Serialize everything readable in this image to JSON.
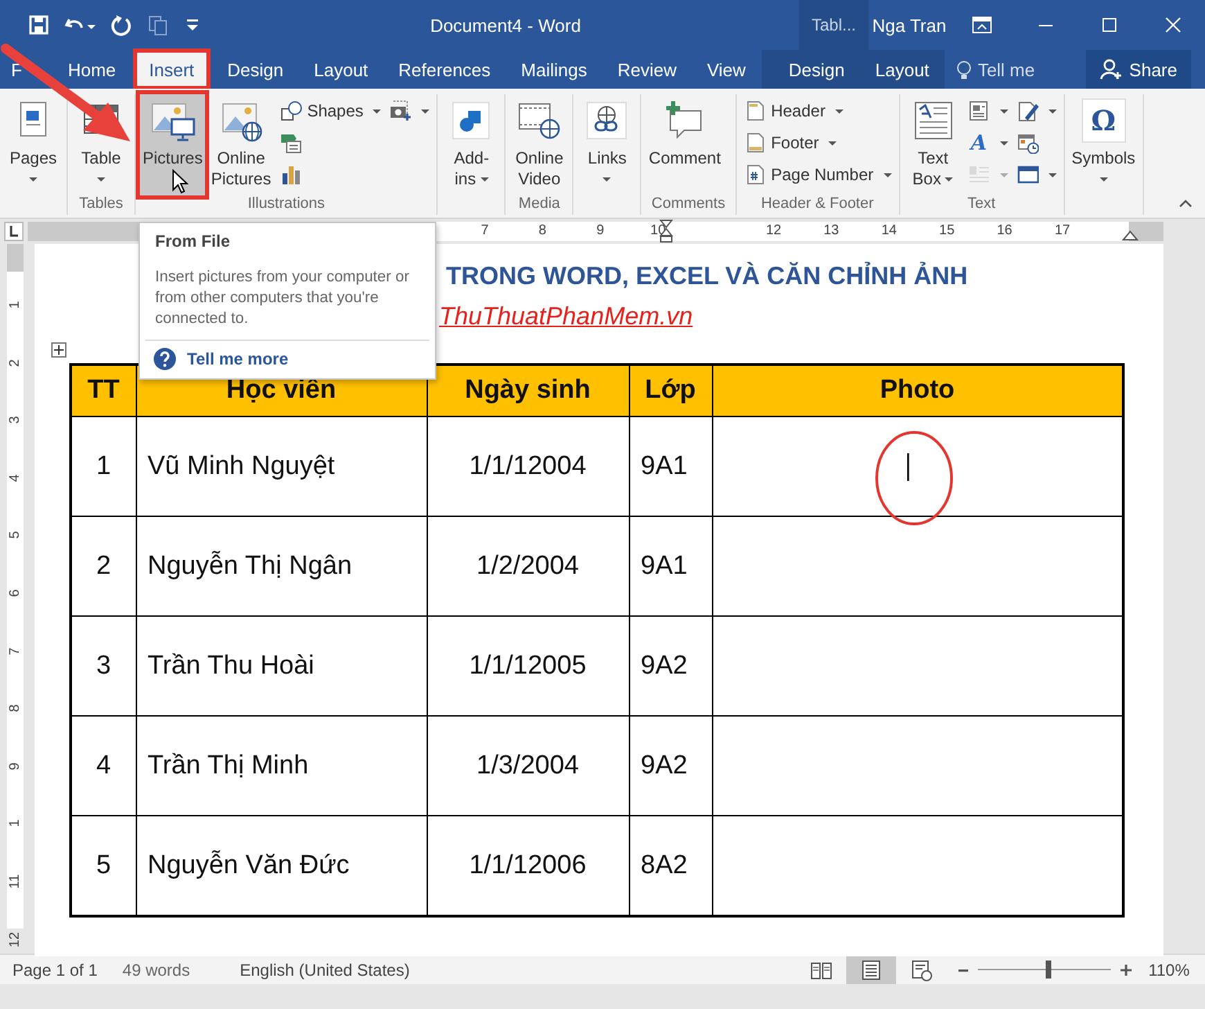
{
  "title_bar": {
    "title": "Document4  -  Word",
    "context_label": "Tabl...",
    "user": "Nga Tran"
  },
  "tabs": [
    {
      "label": "F",
      "selected": false,
      "contextual": false,
      "annotated": false
    },
    {
      "label": "Home",
      "selected": false,
      "contextual": false,
      "annotated": false
    },
    {
      "label": "Insert",
      "selected": true,
      "contextual": false,
      "annotated": true
    },
    {
      "label": "Design",
      "selected": false,
      "contextual": false,
      "annotated": false
    },
    {
      "label": "Layout",
      "selected": false,
      "contextual": false,
      "annotated": false
    },
    {
      "label": "References",
      "selected": false,
      "contextual": false,
      "annotated": false
    },
    {
      "label": "Mailings",
      "selected": false,
      "contextual": false,
      "annotated": false
    },
    {
      "label": "Review",
      "selected": false,
      "contextual": false,
      "annotated": false
    },
    {
      "label": "View",
      "selected": false,
      "contextual": false,
      "annotated": false
    },
    {
      "label": "Design",
      "selected": false,
      "contextual": true,
      "annotated": false
    },
    {
      "label": "Layout",
      "selected": false,
      "contextual": true,
      "annotated": false
    }
  ],
  "tell_me": "Tell me",
  "share": "Share",
  "callout_arrow": true,
  "ribbon": [
    {
      "columns": [
        {
          "kind": "large",
          "label": "Pages",
          "dropdown": true,
          "hovered": false,
          "annotated": false
        }
      ]
    },
    {
      "label": "Tables",
      "columns": [
        {
          "kind": "large",
          "label": "Table",
          "dropdown": true,
          "hovered": false,
          "annotated": false
        }
      ]
    },
    {
      "label": "Illustrations",
      "columns": [
        {
          "kind": "large",
          "label": "Pictures",
          "dropdown": false,
          "hovered": true,
          "annotated": true
        },
        {
          "kind": "large",
          "label": "Online Pictures",
          "dropdown": false,
          "hovered": false,
          "annotated": false
        },
        {
          "kind": "stack",
          "items": [
            {
              "label": "Shapes",
              "dropdown": true
            },
            {
              "dropdown": false
            },
            {
              "dropdown": false
            }
          ]
        },
        {
          "kind": "stack",
          "items": [
            {
              "dropdown": true
            }
          ]
        }
      ]
    },
    {
      "columns": [
        {
          "kind": "large",
          "label": "Add-ins",
          "dropdown": true,
          "hovered": false,
          "annotated": false
        }
      ]
    },
    {
      "label": "Media",
      "columns": [
        {
          "kind": "large",
          "label": "Online Video",
          "dropdown": false,
          "hovered": false,
          "annotated": false
        }
      ]
    },
    {
      "columns": [
        {
          "kind": "large",
          "label": "Links",
          "dropdown": true,
          "hovered": false,
          "annotated": false
        }
      ]
    },
    {
      "label": "Comments",
      "columns": [
        {
          "kind": "large",
          "label": "Comment",
          "dropdown": false,
          "hovered": false,
          "annotated": false
        }
      ]
    },
    {
      "label": "Header & Footer",
      "columns": [
        {
          "kind": "stack",
          "items": [
            {
              "label": "Header",
              "dropdown": true
            },
            {
              "label": "Footer",
              "dropdown": true
            },
            {
              "label": "Page Number",
              "dropdown": true
            }
          ]
        }
      ]
    },
    {
      "label": "Text",
      "columns": [
        {
          "kind": "large",
          "label": "Text Box",
          "dropdown": true,
          "hovered": false,
          "annotated": false
        },
        {
          "kind": "stack",
          "items": [
            {
              "dropdown": true,
              "disabled": false
            },
            {
              "glyph": "A",
              "dropdown": true,
              "disabled": false
            },
            {
              "dropdown": true,
              "disabled": true
            }
          ]
        },
        {
          "kind": "stack",
          "items": [
            {
              "dropdown": true,
              "disabled": false
            },
            {
              "dropdown": false,
              "disabled": false
            },
            {
              "dropdown": true,
              "disabled": false
            }
          ]
        }
      ]
    },
    {
      "columns": [
        {
          "kind": "large",
          "label": "Symbols",
          "glyph": "Ω",
          "dropdown": true,
          "hovered": false,
          "annotated": false
        }
      ]
    }
  ],
  "ruler": {
    "numbers": [
      "7",
      "8",
      "9",
      "10",
      "12",
      "13",
      "14",
      "15",
      "16",
      "17"
    ]
  },
  "vertical_ruler": {
    "numbers": [
      "1",
      "2",
      "3",
      "4",
      "5",
      "6",
      "7",
      "8",
      "9",
      "1",
      "11",
      "12"
    ]
  },
  "tooltip": {
    "title": "From File",
    "text": "Insert pictures from your computer or from other computers that you're connected to.",
    "link": "Tell me more"
  },
  "document": {
    "title": "TRONG WORD, EXCEL VÀ CĂN CHỈNH ẢNH",
    "source": "ThuThuatPhanMem.vn",
    "columns": [
      "TT",
      "Học viên",
      "Ngày sinh",
      "Lớp",
      "Photo"
    ],
    "rows": [
      {
        "cells": [
          "1",
          "Vũ Minh Nguyệt",
          "1/1/12004",
          "9A1"
        ],
        "cursor": true
      },
      {
        "cells": [
          "2",
          "Nguyễn Thị Ngân",
          "1/2/2004",
          "9A1"
        ],
        "cursor": false
      },
      {
        "cells": [
          "3",
          "Trần Thu Hoài",
          "1/1/12005",
          "9A2"
        ],
        "cursor": false
      },
      {
        "cells": [
          "4",
          "Trần Thị Minh",
          "1/3/2004",
          "9A2"
        ],
        "cursor": false
      },
      {
        "cells": [
          "5",
          "Nguyễn Văn Đức",
          "1/1/12006",
          "8A2"
        ],
        "cursor": false
      }
    ]
  },
  "status_bar": {
    "page": "Page 1 of 1",
    "words": "49 words",
    "language": "English (United States)",
    "views": [
      {
        "selected": false
      },
      {
        "selected": true
      },
      {
        "selected": false
      }
    ],
    "zoom": {
      "level": 0.53,
      "reading": "110%"
    }
  }
}
